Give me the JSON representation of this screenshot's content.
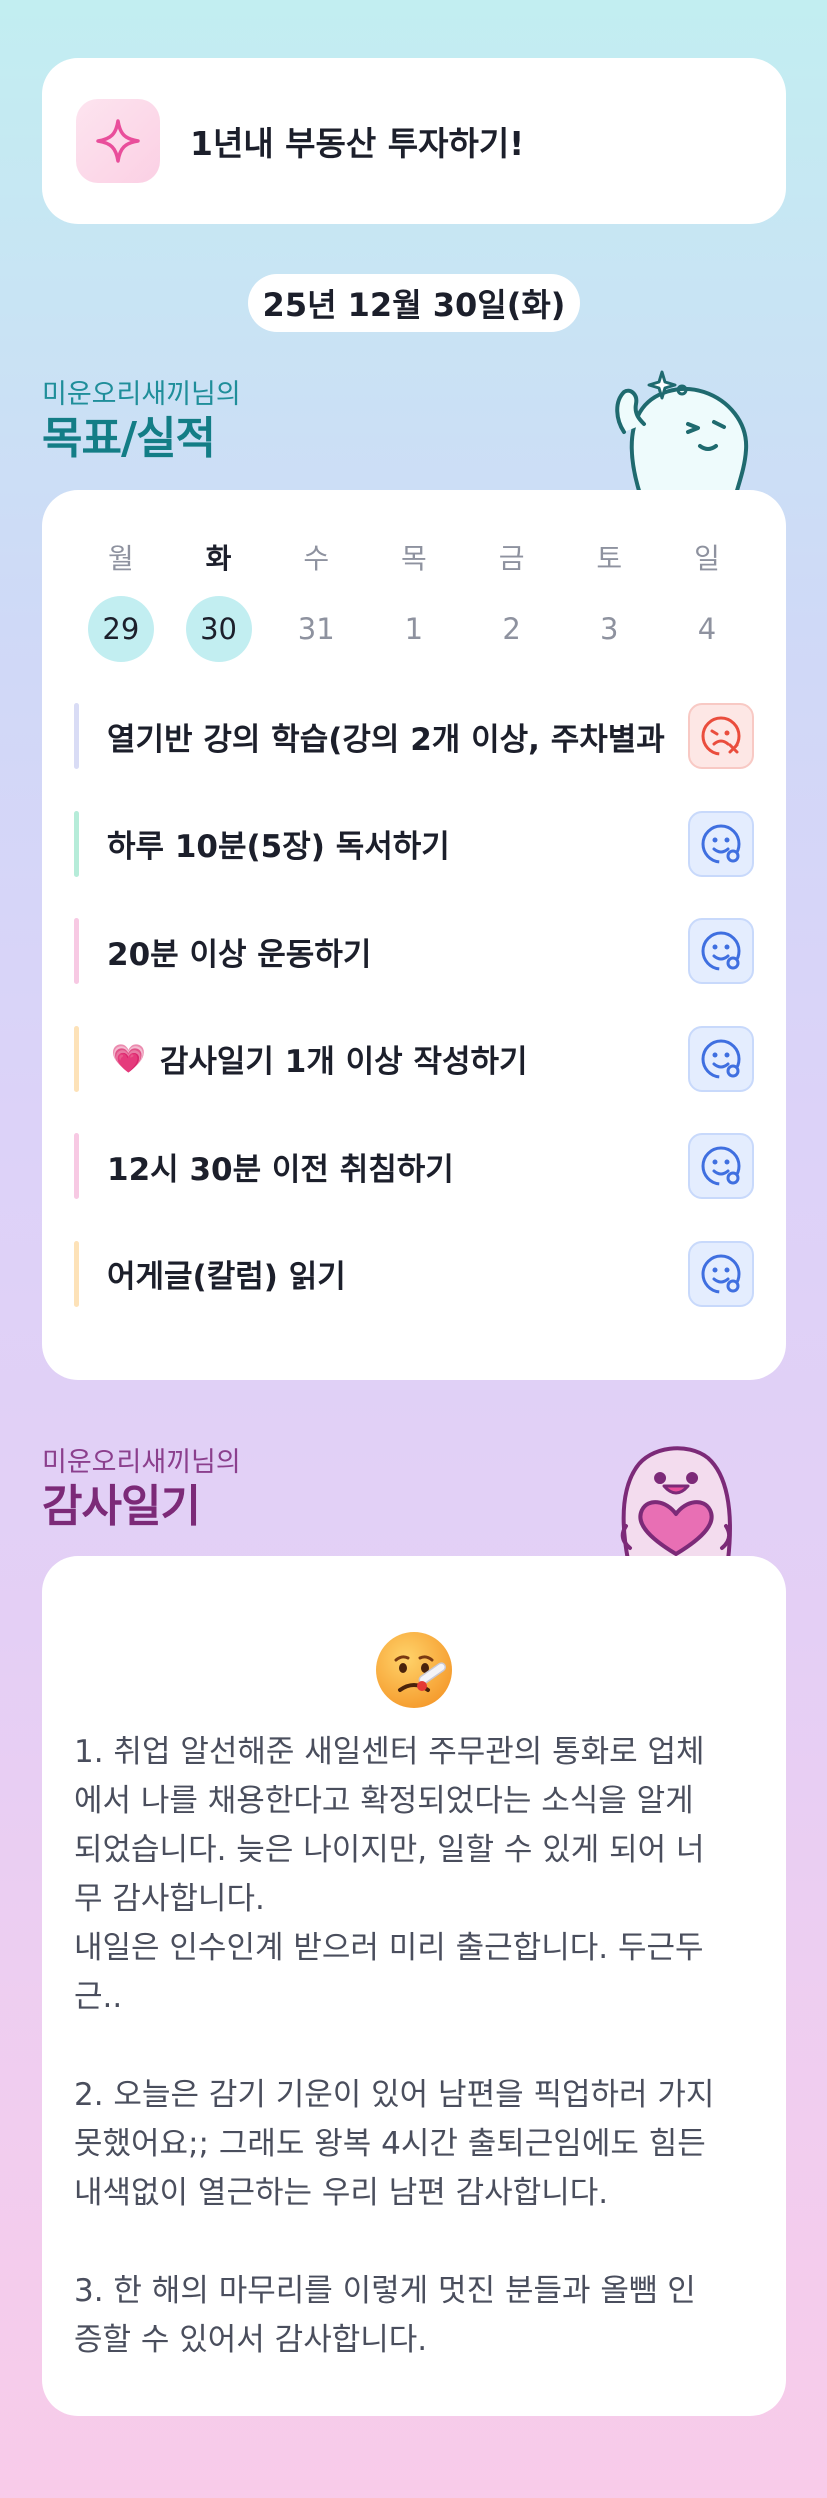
{
  "goal": {
    "title": "1년내 부동산 투자하기!",
    "icon": "sparkle-icon",
    "accent_color": "#e94e9b"
  },
  "date_label": "25년 12월 30일(화)",
  "goals_section": {
    "subtitle": "미운오리새끼님의",
    "title": "목표/실적"
  },
  "week": {
    "days": [
      {
        "name": "월",
        "num": "29",
        "selected": true,
        "bold": false
      },
      {
        "name": "화",
        "num": "30",
        "selected": true,
        "bold": true
      },
      {
        "name": "수",
        "num": "31",
        "selected": false,
        "bold": false
      },
      {
        "name": "목",
        "num": "1",
        "selected": false,
        "bold": false
      },
      {
        "name": "금",
        "num": "2",
        "selected": false,
        "bold": false
      },
      {
        "name": "토",
        "num": "3",
        "selected": false,
        "bold": false
      },
      {
        "name": "일",
        "num": "4",
        "selected": false,
        "bold": false
      }
    ]
  },
  "tasks": [
    {
      "label": "열기반 강의 학습(강의 2개 이상, 주차별과",
      "bar_color": "#d9dcf5",
      "status": "fail",
      "icon": "sad-face-x-icon"
    },
    {
      "label": "하루 10분(5장) 독서하기",
      "bar_color": "#b6ecd9",
      "status": "ok",
      "icon": "smile-face-icon"
    },
    {
      "label": "20분 이상 운동하기",
      "bar_color": "#f7c9e3",
      "status": "ok",
      "icon": "smile-face-icon"
    },
    {
      "label": "감사일기 1개 이상 작성하기",
      "bar_color": "#fde2b8",
      "status": "ok",
      "icon": "smile-face-icon",
      "heart": "💗"
    },
    {
      "label": "12시 30분 이전 취침하기",
      "bar_color": "#f7c9e3",
      "status": "ok",
      "icon": "smile-face-icon"
    },
    {
      "label": "어게글(칼럼) 읽기",
      "bar_color": "#fde2b8",
      "status": "ok",
      "icon": "smile-face-icon"
    }
  ],
  "journal_section": {
    "subtitle": "미운오리새끼님의",
    "title": "감사일기"
  },
  "journal": {
    "mood_icon": "sick-face-thermometer-icon",
    "text": "1. 취업 알선해준 새일센터 주무관의 통화로 업체\n에서 나를 채용한다고 확정되었다는 소식을 알게\n되었습니다. 늦은 나이지만, 일할 수 있게 되어 너\n무 감사합니다.\n내일은 인수인계 받으러 미리 출근합니다. 두근두\n근..\n\n2. 오늘은 감기 기운이 있어 남편을 픽업하러 가지\n못했어요;; 그래도 왕복 4시간 출퇴근임에도 힘든\n내색없이 열근하는 우리 남편 감사합니다.\n\n3. 한 해의 마무리를 이렇게 멋진 분들과 올뺌 인\n증할 수 있어서 감사합니다."
  }
}
